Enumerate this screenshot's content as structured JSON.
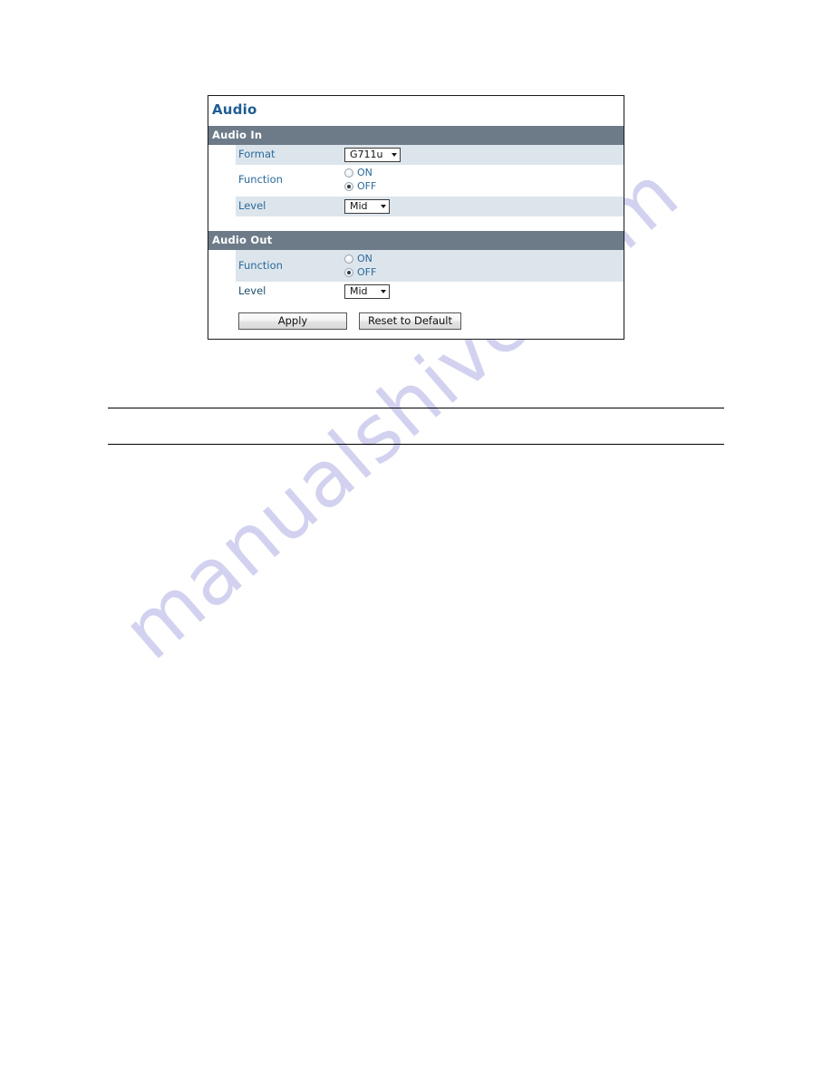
{
  "watermark": {
    "text": "manualshive.com"
  },
  "panel": {
    "title": "Audio",
    "sections": [
      {
        "header": "Audio In",
        "rows": [
          {
            "label": "Format",
            "type": "select",
            "value": "G711u"
          },
          {
            "label": "Function",
            "type": "radio",
            "options": [
              {
                "label": "ON",
                "checked": false
              },
              {
                "label": "OFF",
                "checked": true
              }
            ]
          },
          {
            "label": "Level",
            "type": "select",
            "value": "Mid"
          }
        ]
      },
      {
        "header": "Audio Out",
        "rows": [
          {
            "label": "Function",
            "type": "radio",
            "options": [
              {
                "label": "ON",
                "checked": false
              },
              {
                "label": "OFF",
                "checked": true
              }
            ]
          },
          {
            "label": "Level",
            "type": "select",
            "value": "Mid"
          }
        ]
      }
    ],
    "buttons": {
      "apply": "Apply",
      "reset": "Reset to Default"
    }
  },
  "colors": {
    "title": "#1f5c93",
    "section_header_bg": "#6d7b89",
    "row_shaded_bg": "#dde5ec",
    "label": "#2b6a99",
    "watermark": "#d2d2f0"
  }
}
